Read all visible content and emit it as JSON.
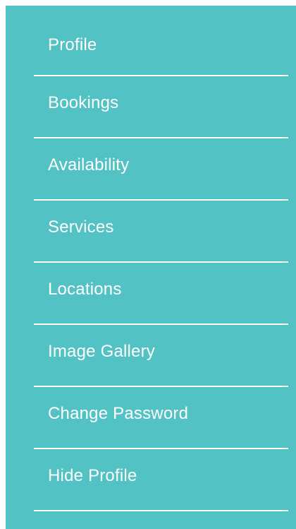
{
  "sidebar": {
    "background_color": "#52c2c4",
    "text_color": "#ffffff",
    "divider_color": "#ffffff",
    "items": [
      {
        "label": "Profile"
      },
      {
        "label": "Bookings"
      },
      {
        "label": "Availability"
      },
      {
        "label": "Services"
      },
      {
        "label": "Locations"
      },
      {
        "label": "Image Gallery"
      },
      {
        "label": "Change Password"
      },
      {
        "label": "Hide Profile"
      }
    ]
  }
}
